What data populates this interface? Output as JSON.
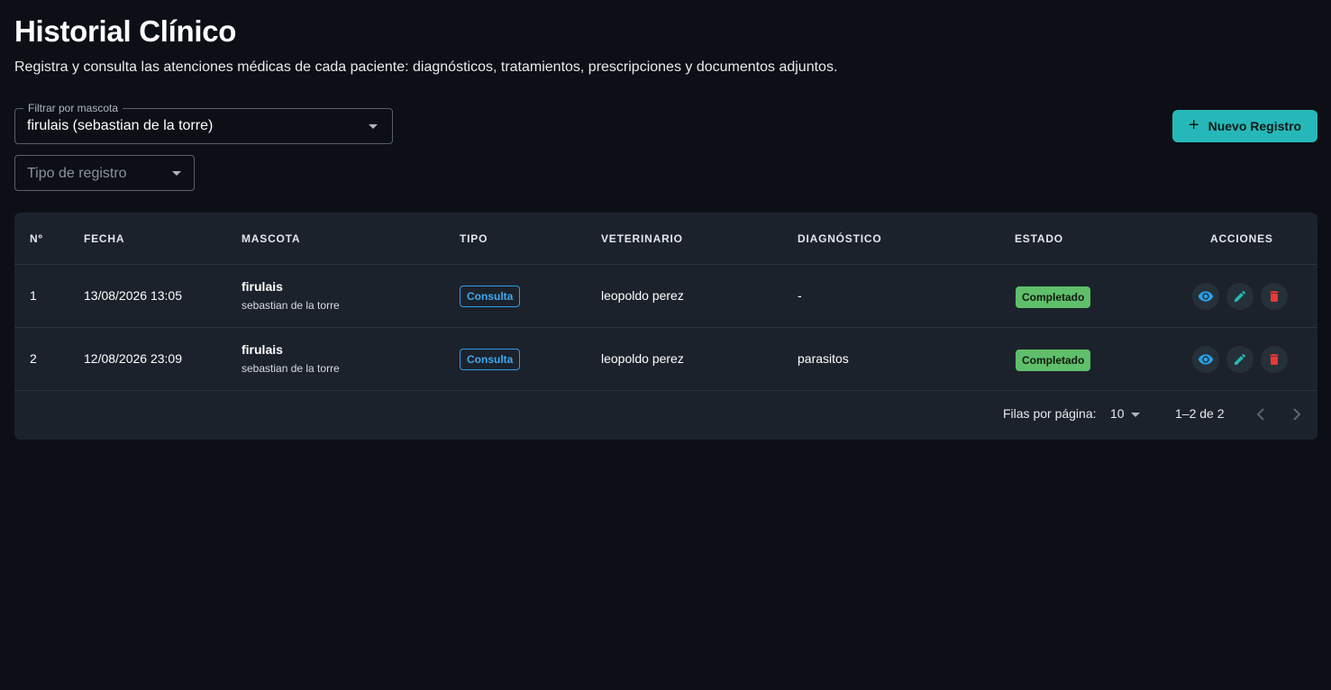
{
  "header": {
    "title": "Historial Clínico",
    "subtitle": "Registra y consulta las atenciones médicas de cada paciente: diagnósticos, tratamientos, prescripciones y documentos adjuntos."
  },
  "filters": {
    "pet": {
      "label": "Filtrar por mascota",
      "value": "firulais (sebastian de la torre)"
    },
    "type": {
      "placeholder": "Tipo de registro"
    }
  },
  "actions": {
    "new_record_label": "Nuevo Registro"
  },
  "table": {
    "columns": [
      "Nº",
      "FECHA",
      "MASCOTA",
      "TIPO",
      "VETERINARIO",
      "DIAGNÓSTICO",
      "ESTADO",
      "ACCIONES"
    ],
    "rows": [
      {
        "num": "1",
        "date": "13/08/2026 13:05",
        "pet": "firulais",
        "owner": "sebastian de la torre",
        "type": "Consulta",
        "vet": "leopoldo perez",
        "diagnosis": "-",
        "status": "Completado"
      },
      {
        "num": "2",
        "date": "12/08/2026 23:09",
        "pet": "firulais",
        "owner": "sebastian de la torre",
        "type": "Consulta",
        "vet": "leopoldo perez",
        "diagnosis": "parasitos",
        "status": "Completado"
      }
    ]
  },
  "pagination": {
    "rows_per_page_label": "Filas por página:",
    "rows_per_page": "10",
    "range": "1–2 de 2"
  },
  "colors": {
    "accent": "#26b8b8",
    "view_icon": "#2b9fe6",
    "edit_icon": "#26b8b8",
    "delete_icon": "#e53935",
    "status_bg": "#5fbf6a",
    "type_chip": "#2b9fe6"
  },
  "icons": {
    "view": "eye-icon",
    "edit": "pencil-icon",
    "delete": "trash-icon",
    "add": "plus-icon",
    "prev": "chevron-left-icon",
    "next": "chevron-right-icon"
  }
}
